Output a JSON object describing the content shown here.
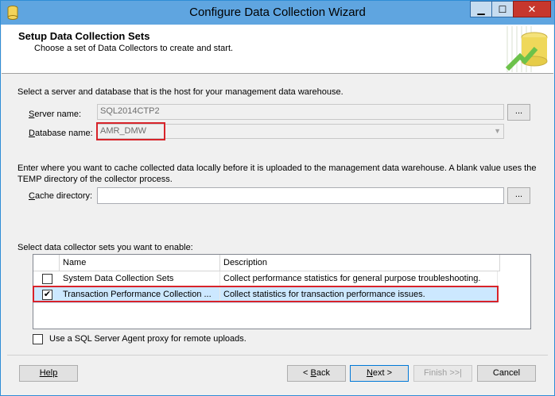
{
  "window": {
    "title": "Configure Data Collection Wizard"
  },
  "titlebar_buttons": {
    "minimize": "▁",
    "maximize": "☐",
    "close": "✕"
  },
  "header": {
    "title": "Setup Data Collection Sets",
    "subtitle": "Choose a set of Data Collectors to create and start."
  },
  "server_section": {
    "instruction": "Select a server and database that is the host for your management data warehouse.",
    "server_label_key": "S",
    "server_label_rest": "erver name:",
    "server_value": "SQL2014CTP2",
    "db_label_key": "D",
    "db_label_rest": "atabase name:",
    "db_value": "AMR_DMW",
    "browse_label": "..."
  },
  "cache_section": {
    "instruction_line1": "Enter where you want to cache collected data locally before it is uploaded to the management data warehouse. A blank value uses the",
    "instruction_line2": "TEMP directory of the collector process.",
    "cache_label_key": "C",
    "cache_label_rest": "ache directory:",
    "cache_value": "",
    "browse_label": "..."
  },
  "collector_sets": {
    "instruction": "Select data collector sets you want to enable:",
    "columns": [
      "Name",
      "Description"
    ],
    "rows": [
      {
        "checked": "",
        "name": "System Data Collection Sets",
        "description": "Collect performance statistics for general purpose troubleshooting."
      },
      {
        "checked": "✔",
        "name": "Transaction Performance Collection ...",
        "description": "Collect statistics for transaction performance issues."
      }
    ]
  },
  "proxy_option": {
    "label": "Use a SQL Server Agent proxy for remote uploads.",
    "checked": ""
  },
  "buttons": {
    "help": "Help",
    "back_key": "B",
    "back_prefix": "< ",
    "back_rest": "ack",
    "next_key": "N",
    "next_rest": "ext >",
    "finish": "Finish >>|",
    "cancel": "Cancel"
  },
  "colors": {
    "titlebar": "#5fa5e0",
    "highlight_box": "#d8232a",
    "selected_row": "#cce8ff"
  }
}
